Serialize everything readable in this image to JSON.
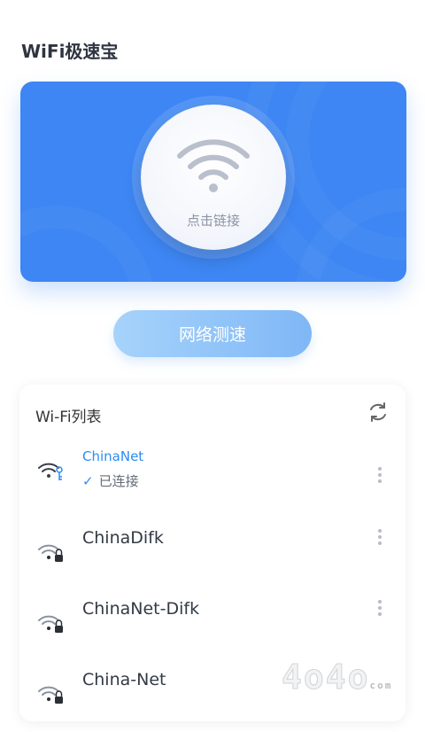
{
  "app": {
    "title": "WiFi极速宝"
  },
  "hero": {
    "connect_label": "点击链接"
  },
  "speed_test": {
    "label": "网络测速"
  },
  "wifi_list": {
    "title": "Wi-Fi列表",
    "networks": [
      {
        "ssid": "ChinaNet",
        "status": "已连接",
        "icon": "wifi-key-icon"
      },
      {
        "ssid": "ChinaDifk",
        "icon": "wifi-lock-icon"
      },
      {
        "ssid": "ChinaNet-Difk",
        "icon": "wifi-lock-icon"
      },
      {
        "ssid": "China-Net",
        "icon": "wifi-lock-icon"
      }
    ]
  },
  "colors": {
    "accent": "#3d86f3",
    "button": "#7fb7f6",
    "connected": "#2d8cf0"
  },
  "watermark": {
    "text": "4o4o",
    "suffix": "com"
  }
}
